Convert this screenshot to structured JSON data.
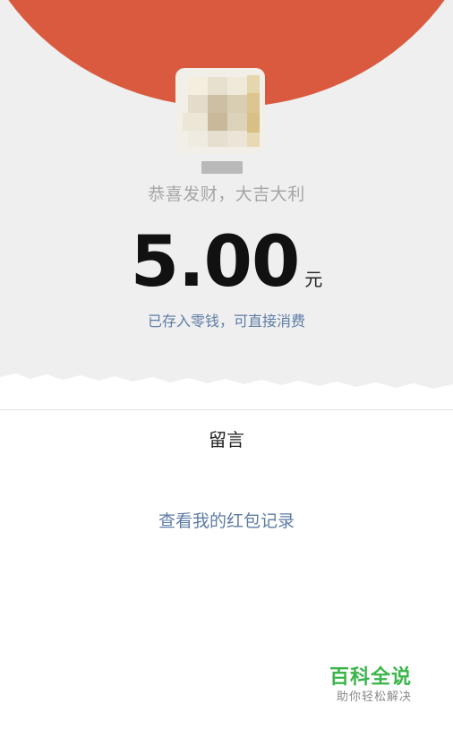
{
  "envelope": {
    "greeting": "恭喜发财，大吉大利",
    "amount": "5.00",
    "unit": "元",
    "balance_note": "已存入零钱，可直接消费"
  },
  "actions": {
    "message_label": "留言",
    "records_label": "查看我的红包记录"
  },
  "watermark": {
    "title": "百科全说",
    "subtitle": "助你轻松解决"
  },
  "colors": {
    "header_red": "#d95a3e",
    "link_blue": "#5d7ca6",
    "watermark_green": "#3bb54a"
  }
}
